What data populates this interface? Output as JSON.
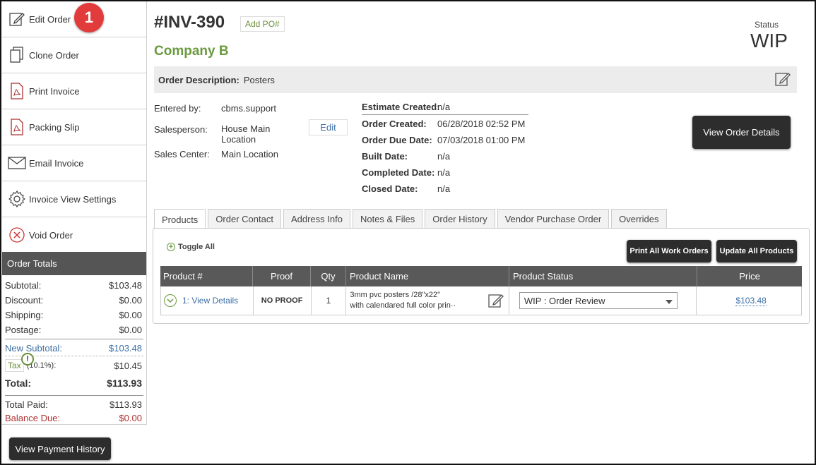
{
  "sidebar": {
    "items": [
      {
        "label": "Edit Order",
        "icon": "edit-icon"
      },
      {
        "label": "Clone Order",
        "icon": "copy-icon"
      },
      {
        "label": "Print Invoice",
        "icon": "pdf-icon"
      },
      {
        "label": "Packing Slip",
        "icon": "pdf-icon"
      },
      {
        "label": "Email Invoice",
        "icon": "envelope-icon"
      },
      {
        "label": "Invoice View Settings",
        "icon": "gear-icon"
      },
      {
        "label": "Void Order",
        "icon": "void-icon"
      }
    ],
    "step_badge": "1"
  },
  "totals": {
    "header": "Order Totals",
    "subtotal_label": "Subtotal:",
    "subtotal": "$103.48",
    "discount_label": "Discount:",
    "discount": "$0.00",
    "shipping_label": "Shipping:",
    "shipping": "$0.00",
    "postage_label": "Postage:",
    "postage": "$0.00",
    "new_subtotal_label": "New Subtotal:",
    "new_subtotal": "$103.48",
    "tax_label": "Tax",
    "tax_rate": "(10.1%):",
    "tax": "$10.45",
    "total_label": "Total:",
    "total": "$113.93",
    "total_paid_label": "Total Paid:",
    "total_paid": "$113.93",
    "balance_due_label": "Balance Due:",
    "balance_due": "$0.00"
  },
  "payment_history_button": "View Payment History",
  "order": {
    "number": "#INV-390",
    "add_po": "Add PO#",
    "company": "Company B",
    "status_label": "Status",
    "status": "WIP",
    "description_label": "Order Description:",
    "description": "Posters",
    "entered_by_label": "Entered by:",
    "entered_by": "cbms.support",
    "salesperson_label": "Salesperson:",
    "salesperson_line1": "House Main",
    "salesperson_line2": "Location",
    "edit_label": "Edit",
    "sales_center_label": "Sales Center:",
    "sales_center": "Main Location",
    "estimate_created_label": "Estimate Created:",
    "estimate_created": "n/a",
    "order_created_label": "Order Created:",
    "order_created": "06/28/2018 02:52 PM",
    "order_due_label": "Order Due Date:",
    "order_due": "07/03/2018 01:00 PM",
    "built_label": "Built Date:",
    "built": "n/a",
    "completed_label": "Completed Date:",
    "completed": "n/a",
    "closed_label": "Closed Date:",
    "closed": "n/a",
    "view_details_button": "View Order Details"
  },
  "tabs": [
    "Products",
    "Order Contact",
    "Address Info",
    "Notes & Files",
    "Order History",
    "Vendor Purchase Order",
    "Overrides"
  ],
  "products": {
    "toggle_all": "Toggle All",
    "print_work_orders": "Print All Work Orders",
    "update_all": "Update All Products",
    "columns": [
      "Product #",
      "Proof",
      "Qty",
      "Product Name",
      "Product Status",
      "Price"
    ],
    "rows": [
      {
        "number": "1: View Details",
        "proof": "NO PROOF",
        "qty": "1",
        "name_line1": "3mm pvc posters /28\"x22\"",
        "name_line2": "with calendared full color prin··",
        "status": "WIP : Order Review",
        "price": "$103.48"
      }
    ]
  }
}
